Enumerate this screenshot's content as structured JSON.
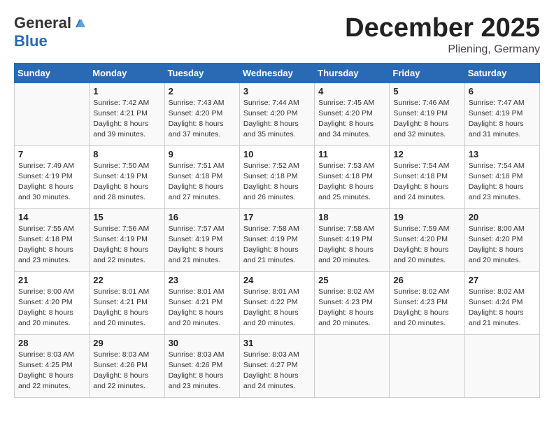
{
  "header": {
    "logo_general": "General",
    "logo_blue": "Blue",
    "month": "December 2025",
    "location": "Pliening, Germany"
  },
  "days_of_week": [
    "Sunday",
    "Monday",
    "Tuesday",
    "Wednesday",
    "Thursday",
    "Friday",
    "Saturday"
  ],
  "weeks": [
    [
      {
        "day": "",
        "info": ""
      },
      {
        "day": "1",
        "info": "Sunrise: 7:42 AM\nSunset: 4:21 PM\nDaylight: 8 hours\nand 39 minutes."
      },
      {
        "day": "2",
        "info": "Sunrise: 7:43 AM\nSunset: 4:20 PM\nDaylight: 8 hours\nand 37 minutes."
      },
      {
        "day": "3",
        "info": "Sunrise: 7:44 AM\nSunset: 4:20 PM\nDaylight: 8 hours\nand 35 minutes."
      },
      {
        "day": "4",
        "info": "Sunrise: 7:45 AM\nSunset: 4:20 PM\nDaylight: 8 hours\nand 34 minutes."
      },
      {
        "day": "5",
        "info": "Sunrise: 7:46 AM\nSunset: 4:19 PM\nDaylight: 8 hours\nand 32 minutes."
      },
      {
        "day": "6",
        "info": "Sunrise: 7:47 AM\nSunset: 4:19 PM\nDaylight: 8 hours\nand 31 minutes."
      }
    ],
    [
      {
        "day": "7",
        "info": "Sunrise: 7:49 AM\nSunset: 4:19 PM\nDaylight: 8 hours\nand 30 minutes."
      },
      {
        "day": "8",
        "info": "Sunrise: 7:50 AM\nSunset: 4:19 PM\nDaylight: 8 hours\nand 28 minutes."
      },
      {
        "day": "9",
        "info": "Sunrise: 7:51 AM\nSunset: 4:18 PM\nDaylight: 8 hours\nand 27 minutes."
      },
      {
        "day": "10",
        "info": "Sunrise: 7:52 AM\nSunset: 4:18 PM\nDaylight: 8 hours\nand 26 minutes."
      },
      {
        "day": "11",
        "info": "Sunrise: 7:53 AM\nSunset: 4:18 PM\nDaylight: 8 hours\nand 25 minutes."
      },
      {
        "day": "12",
        "info": "Sunrise: 7:54 AM\nSunset: 4:18 PM\nDaylight: 8 hours\nand 24 minutes."
      },
      {
        "day": "13",
        "info": "Sunrise: 7:54 AM\nSunset: 4:18 PM\nDaylight: 8 hours\nand 23 minutes."
      }
    ],
    [
      {
        "day": "14",
        "info": "Sunrise: 7:55 AM\nSunset: 4:18 PM\nDaylight: 8 hours\nand 23 minutes."
      },
      {
        "day": "15",
        "info": "Sunrise: 7:56 AM\nSunset: 4:19 PM\nDaylight: 8 hours\nand 22 minutes."
      },
      {
        "day": "16",
        "info": "Sunrise: 7:57 AM\nSunset: 4:19 PM\nDaylight: 8 hours\nand 21 minutes."
      },
      {
        "day": "17",
        "info": "Sunrise: 7:58 AM\nSunset: 4:19 PM\nDaylight: 8 hours\nand 21 minutes."
      },
      {
        "day": "18",
        "info": "Sunrise: 7:58 AM\nSunset: 4:19 PM\nDaylight: 8 hours\nand 20 minutes."
      },
      {
        "day": "19",
        "info": "Sunrise: 7:59 AM\nSunset: 4:20 PM\nDaylight: 8 hours\nand 20 minutes."
      },
      {
        "day": "20",
        "info": "Sunrise: 8:00 AM\nSunset: 4:20 PM\nDaylight: 8 hours\nand 20 minutes."
      }
    ],
    [
      {
        "day": "21",
        "info": "Sunrise: 8:00 AM\nSunset: 4:20 PM\nDaylight: 8 hours\nand 20 minutes."
      },
      {
        "day": "22",
        "info": "Sunrise: 8:01 AM\nSunset: 4:21 PM\nDaylight: 8 hours\nand 20 minutes."
      },
      {
        "day": "23",
        "info": "Sunrise: 8:01 AM\nSunset: 4:21 PM\nDaylight: 8 hours\nand 20 minutes."
      },
      {
        "day": "24",
        "info": "Sunrise: 8:01 AM\nSunset: 4:22 PM\nDaylight: 8 hours\nand 20 minutes."
      },
      {
        "day": "25",
        "info": "Sunrise: 8:02 AM\nSunset: 4:23 PM\nDaylight: 8 hours\nand 20 minutes."
      },
      {
        "day": "26",
        "info": "Sunrise: 8:02 AM\nSunset: 4:23 PM\nDaylight: 8 hours\nand 20 minutes."
      },
      {
        "day": "27",
        "info": "Sunrise: 8:02 AM\nSunset: 4:24 PM\nDaylight: 8 hours\nand 21 minutes."
      }
    ],
    [
      {
        "day": "28",
        "info": "Sunrise: 8:03 AM\nSunset: 4:25 PM\nDaylight: 8 hours\nand 22 minutes."
      },
      {
        "day": "29",
        "info": "Sunrise: 8:03 AM\nSunset: 4:26 PM\nDaylight: 8 hours\nand 22 minutes."
      },
      {
        "day": "30",
        "info": "Sunrise: 8:03 AM\nSunset: 4:26 PM\nDaylight: 8 hours\nand 23 minutes."
      },
      {
        "day": "31",
        "info": "Sunrise: 8:03 AM\nSunset: 4:27 PM\nDaylight: 8 hours\nand 24 minutes."
      },
      {
        "day": "",
        "info": ""
      },
      {
        "day": "",
        "info": ""
      },
      {
        "day": "",
        "info": ""
      }
    ]
  ]
}
